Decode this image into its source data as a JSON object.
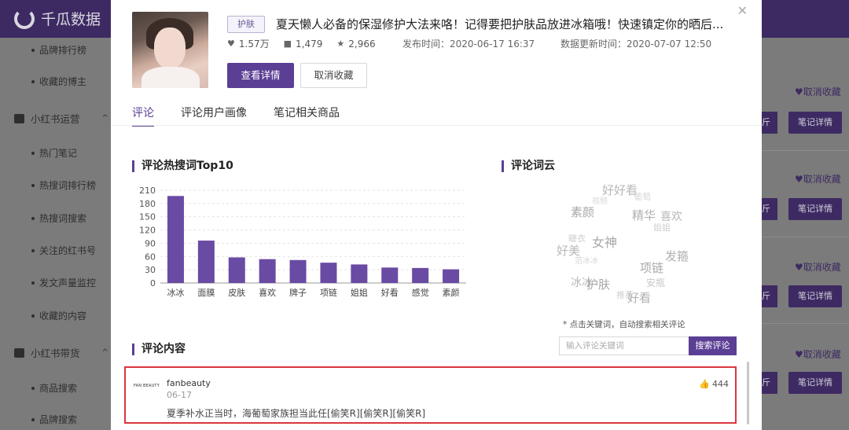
{
  "app": {
    "name": "千瓜数据"
  },
  "sidebar": {
    "items": [
      {
        "label": "品牌排行榜",
        "type": "sub"
      },
      {
        "label": "收藏的博主",
        "type": "sub"
      },
      {
        "label": "小红书运营",
        "type": "group",
        "icon": "bookmark-icon"
      },
      {
        "label": "热门笔记",
        "type": "sub"
      },
      {
        "label": "热搜词排行榜",
        "type": "sub"
      },
      {
        "label": "热搜词搜索",
        "type": "sub"
      },
      {
        "label": "关注的红书号",
        "type": "sub"
      },
      {
        "label": "发文声量监控",
        "type": "sub"
      },
      {
        "label": "收藏的内容",
        "type": "sub"
      },
      {
        "label": "小红书带货",
        "type": "group",
        "icon": "bag-icon"
      },
      {
        "label": "商品搜索",
        "type": "sub"
      },
      {
        "label": "品牌搜索",
        "type": "sub"
      }
    ]
  },
  "background_list": {
    "unfavorite_label": "取消收藏",
    "detail_label": "笔记详情",
    "prev_label": "斤"
  },
  "modal": {
    "close_icon": "close-icon",
    "note": {
      "tag": "护肤",
      "title": "夏天懒人必备的保湿修护大法来咯！记得要把护肤品放进冰箱哦！快速镇定你的晒后...",
      "likes": "1.57万",
      "comments": "1,479",
      "collects": "2,966",
      "publish_label": "发布时间：",
      "publish_time": "2020-06-17 16:37",
      "update_label": "数据更新时间：",
      "update_time": "2020-07-07 12:50"
    },
    "buttons": {
      "view_detail": "查看详情",
      "unfavorite": "取消收藏"
    },
    "tabs": [
      {
        "label": "评论",
        "active": true
      },
      {
        "label": "评论用户画像",
        "active": false
      },
      {
        "label": "笔记相关商品",
        "active": false
      }
    ],
    "hot_words_title": "评论热搜词Top10",
    "word_cloud_title": "评论词云",
    "word_cloud_note": "* 点击关键词，自动搜索相关评论",
    "cloud_words": [
      {
        "text": "好好看",
        "color": "#b8b8b8"
      },
      {
        "text": "葡萄",
        "color": "#d8d8d8"
      },
      {
        "text": "视频",
        "color": "#d8d8d8"
      },
      {
        "text": "素颜",
        "color": "#a8a8a8"
      },
      {
        "text": "精华",
        "color": "#b0b0b0"
      },
      {
        "text": "喜欢",
        "color": "#b8b8b8"
      },
      {
        "text": "姐姐",
        "color": "#d0d0d0"
      },
      {
        "text": "女神",
        "color": "#a8a8a8"
      },
      {
        "text": "睫衣",
        "color": "#cfcfcf"
      },
      {
        "text": "好美",
        "color": "#b8b8b8"
      },
      {
        "text": "发箍",
        "color": "#b0b0b0"
      },
      {
        "text": "项链",
        "color": "#a8a8a8"
      },
      {
        "text": "范冰冰",
        "color": "#d6d6d6"
      },
      {
        "text": "冰冰",
        "color": "#b8b8b8"
      },
      {
        "text": "护肤",
        "color": "#a8a8a8"
      },
      {
        "text": "安瓶",
        "color": "#c8c8c8"
      },
      {
        "text": "推荐",
        "color": "#d0d0d0"
      },
      {
        "text": "好看",
        "color": "#b0b0b0"
      }
    ],
    "search": {
      "placeholder": "输入评论关键词",
      "button": "搜索评论"
    },
    "comments_title": "评论内容",
    "comment": {
      "avatar_text": "FAN BEAUTY",
      "user": "fanbeauty",
      "date": "06-17",
      "text": "夏季补水正当时，海葡萄家族担当此任[偷笑R][偷笑R][偷笑R]",
      "likes": "444"
    }
  },
  "colors": {
    "primary": "#5b3f95",
    "bar": "#6a4ba3",
    "highlight_border": "#d9363e"
  },
  "chart_data": {
    "type": "bar",
    "title": "评论热搜词Top10",
    "categories": [
      "冰冰",
      "面膜",
      "皮肤",
      "喜欢",
      "牌子",
      "项链",
      "姐姐",
      "好看",
      "感觉",
      "素颜"
    ],
    "values": [
      197,
      96,
      58,
      54,
      52,
      46,
      42,
      35,
      34,
      31
    ],
    "yticks": [
      0,
      30,
      60,
      90,
      120,
      150,
      180,
      210
    ],
    "ylim": [
      0,
      210
    ],
    "grid": true
  }
}
